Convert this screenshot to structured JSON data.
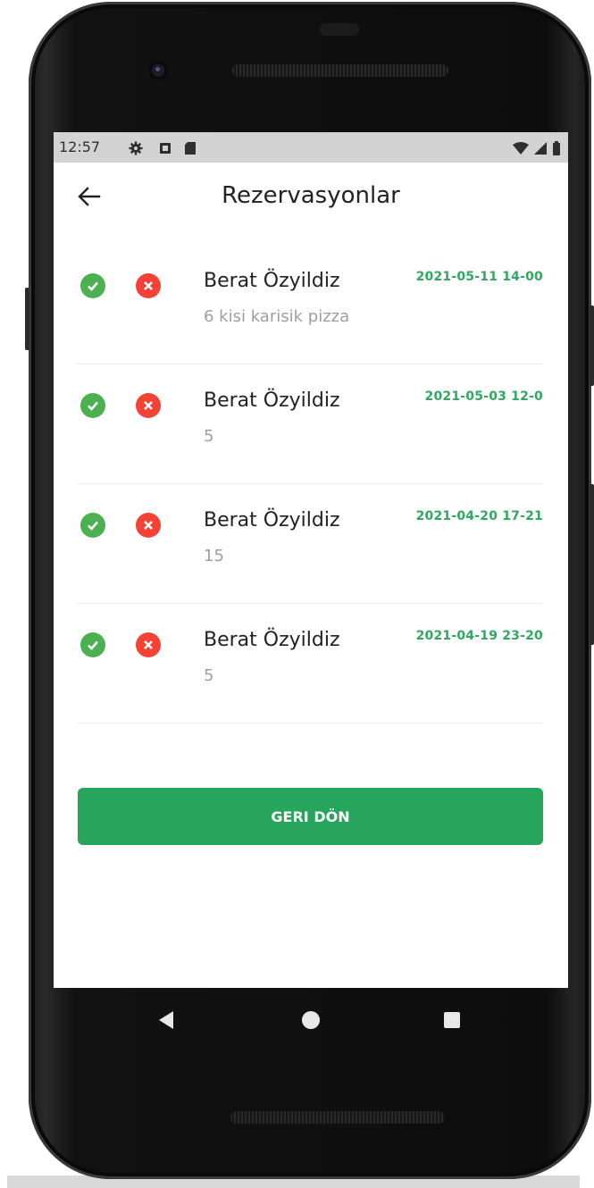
{
  "statusbar": {
    "time": "12:57",
    "icons": [
      "gear-icon",
      "a-box-icon",
      "sd-card-icon"
    ],
    "right_icons": [
      "wifi-icon",
      "signal-icon",
      "battery-icon"
    ]
  },
  "appbar": {
    "title": "Rezervasyonlar",
    "back_icon": "arrow-left-icon"
  },
  "reservations": [
    {
      "name": "Berat Özyildiz",
      "note": "6 kisi karisik pizza",
      "date": "2021-05-11 14-00"
    },
    {
      "name": "Berat Özyildiz",
      "note": "5",
      "date": "2021-05-03 12-0"
    },
    {
      "name": "Berat Özyildiz",
      "note": "15",
      "date": "2021-04-20 17-21"
    },
    {
      "name": "Berat Özyildiz",
      "note": "5",
      "date": "2021-04-19 23-20"
    }
  ],
  "actions": {
    "back_label": "GERI DÖN"
  },
  "colors": {
    "accent_green": "#27a55c",
    "accept_green": "#4caf50",
    "reject_red": "#f44336",
    "date_green": "#2fa860"
  },
  "navbar": {
    "icons": [
      "nav-back-icon",
      "nav-home-icon",
      "nav-recents-icon"
    ]
  }
}
